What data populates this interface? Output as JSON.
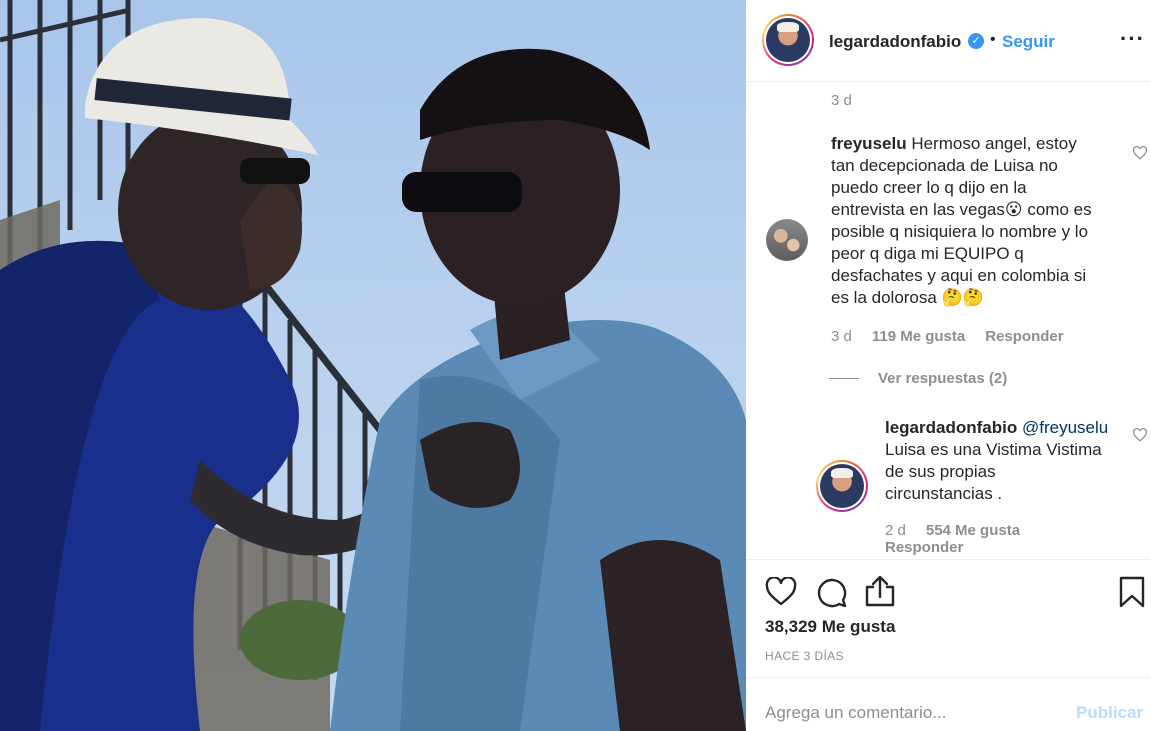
{
  "header": {
    "username": "legardadonfabio",
    "separator": "•",
    "follow_label": "Seguir",
    "more_icon": "more-options-icon"
  },
  "comments": {
    "top_timestamp": "3 d",
    "main_comment": {
      "username": "freyuselu",
      "text": "Hermoso angel, estoy tan decepcionada de Luisa no puedo creer lo q dijo en la entrevista en las vegas😮 como es posible q nisiquiera lo nombre y lo peor q diga mi EQUIPO q desfachates y aqui en colombia si es la dolorosa 🤔🤔",
      "lines": [
        "Hermoso angel, estoy",
        "tan decepcionada de Luisa no",
        "puedo creer lo q dijo en la",
        "entrevista en las vegas😮 como es",
        "posible q nisiquiera lo nombre y lo",
        "peor q diga mi EQUIPO q",
        "desfachates y aqui en colombia si",
        "es la dolorosa 🤔🤔"
      ],
      "time": "3 d",
      "likes": "119 Me gusta",
      "reply_label": "Responder"
    },
    "view_replies": "Ver respuestas (2)",
    "reply": {
      "username": "legardadonfabio",
      "mention": "@freyuselu",
      "lines": [
        "Luisa es una Vistima Vistima",
        "de sus propias",
        "circunstancias ."
      ],
      "time": "2 d",
      "likes": "554 Me gusta",
      "reply_label": "Responder"
    }
  },
  "actions": {
    "like_icon": "heart-icon",
    "comment_icon": "comment-icon",
    "share_icon": "share-icon",
    "save_icon": "bookmark-icon",
    "likes_count": "38,329 Me gusta",
    "posted_ago": "HACE 3 DÍAS"
  },
  "add_comment": {
    "placeholder": "Agrega un comentario...",
    "post_label": "Publicar"
  },
  "colors": {
    "accent": "#3897f0",
    "muted": "#8e8e8e",
    "text": "#262626",
    "post_disabled": "#b2dffc",
    "divider": "#efefef"
  }
}
